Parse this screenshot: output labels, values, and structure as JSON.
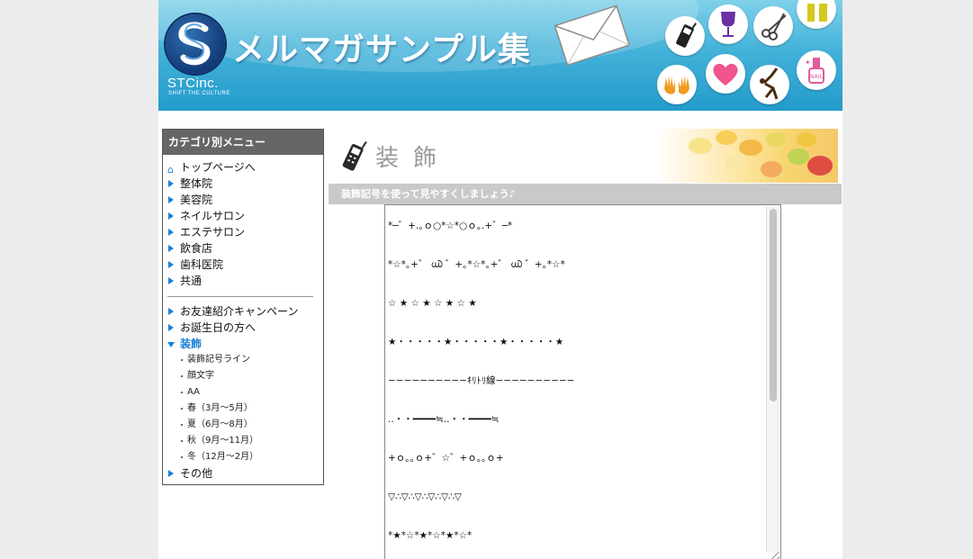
{
  "header": {
    "logo_name": "STCinc.",
    "logo_tagline": "SHIFT THE CULTURE",
    "site_title": "メルマガサンプル集"
  },
  "sidebar": {
    "heading": "カテゴリ別メニュー",
    "items": [
      {
        "label": "トップページへ",
        "icon": "home-icon"
      },
      {
        "label": "整体院",
        "icon": "triangle-right-icon"
      },
      {
        "label": "美容院",
        "icon": "triangle-right-icon"
      },
      {
        "label": "ネイルサロン",
        "icon": "triangle-right-icon"
      },
      {
        "label": "エステサロン",
        "icon": "triangle-right-icon"
      },
      {
        "label": "飲食店",
        "icon": "triangle-right-icon"
      },
      {
        "label": "歯科医院",
        "icon": "triangle-right-icon"
      },
      {
        "label": "共通",
        "icon": "triangle-right-icon"
      }
    ],
    "items2": [
      {
        "label": "お友達紹介キャンペーン",
        "icon": "triangle-right-icon"
      },
      {
        "label": "お誕生日の方へ",
        "icon": "triangle-right-icon"
      },
      {
        "label": "装飾",
        "icon": "triangle-down-icon",
        "active": true
      }
    ],
    "subitems": [
      "装飾記号ライン",
      "顔文字",
      "AA",
      "春（3月〜5月）",
      "夏（6月〜8月）",
      "秋（9月〜11月）",
      "冬（12月〜2月）"
    ],
    "last_item": {
      "label": "その他",
      "icon": "triangle-right-icon"
    }
  },
  "main": {
    "title": "装飾",
    "subtitle": "装飾記号を使って見やすくしましょう♪",
    "textarea_lines": [
      "*─゛+.｡ｏ○*☆*○ｏ｡.+゛─*",
      "*☆*｡+゛ ൘ ゛+｡*☆*｡+゛ ൘ ゛+｡*☆*",
      "☆ ★ ☆ ★ ☆ ★ ☆ ★",
      "★・・・・・★・・・・・★・・・・・★",
      "−−−−−−−−−−ｷﾘﾄﾘ線−−−−−−−−−−",
      "..・・━━━━≒..・・━━━━≒",
      "+ｏ｡｡ｏ+゛☆゛+ｏ｡｡ｏ+",
      "▽∴▽∴▽∴▽∴▽∴▽",
      "*★*☆*★*☆*★*☆*"
    ]
  },
  "colors": {
    "accent": "#1a7fd4",
    "header_blue": "#239bcb",
    "sidebar_head": "#666666",
    "subtitle_bar": "#c9c9c9"
  }
}
